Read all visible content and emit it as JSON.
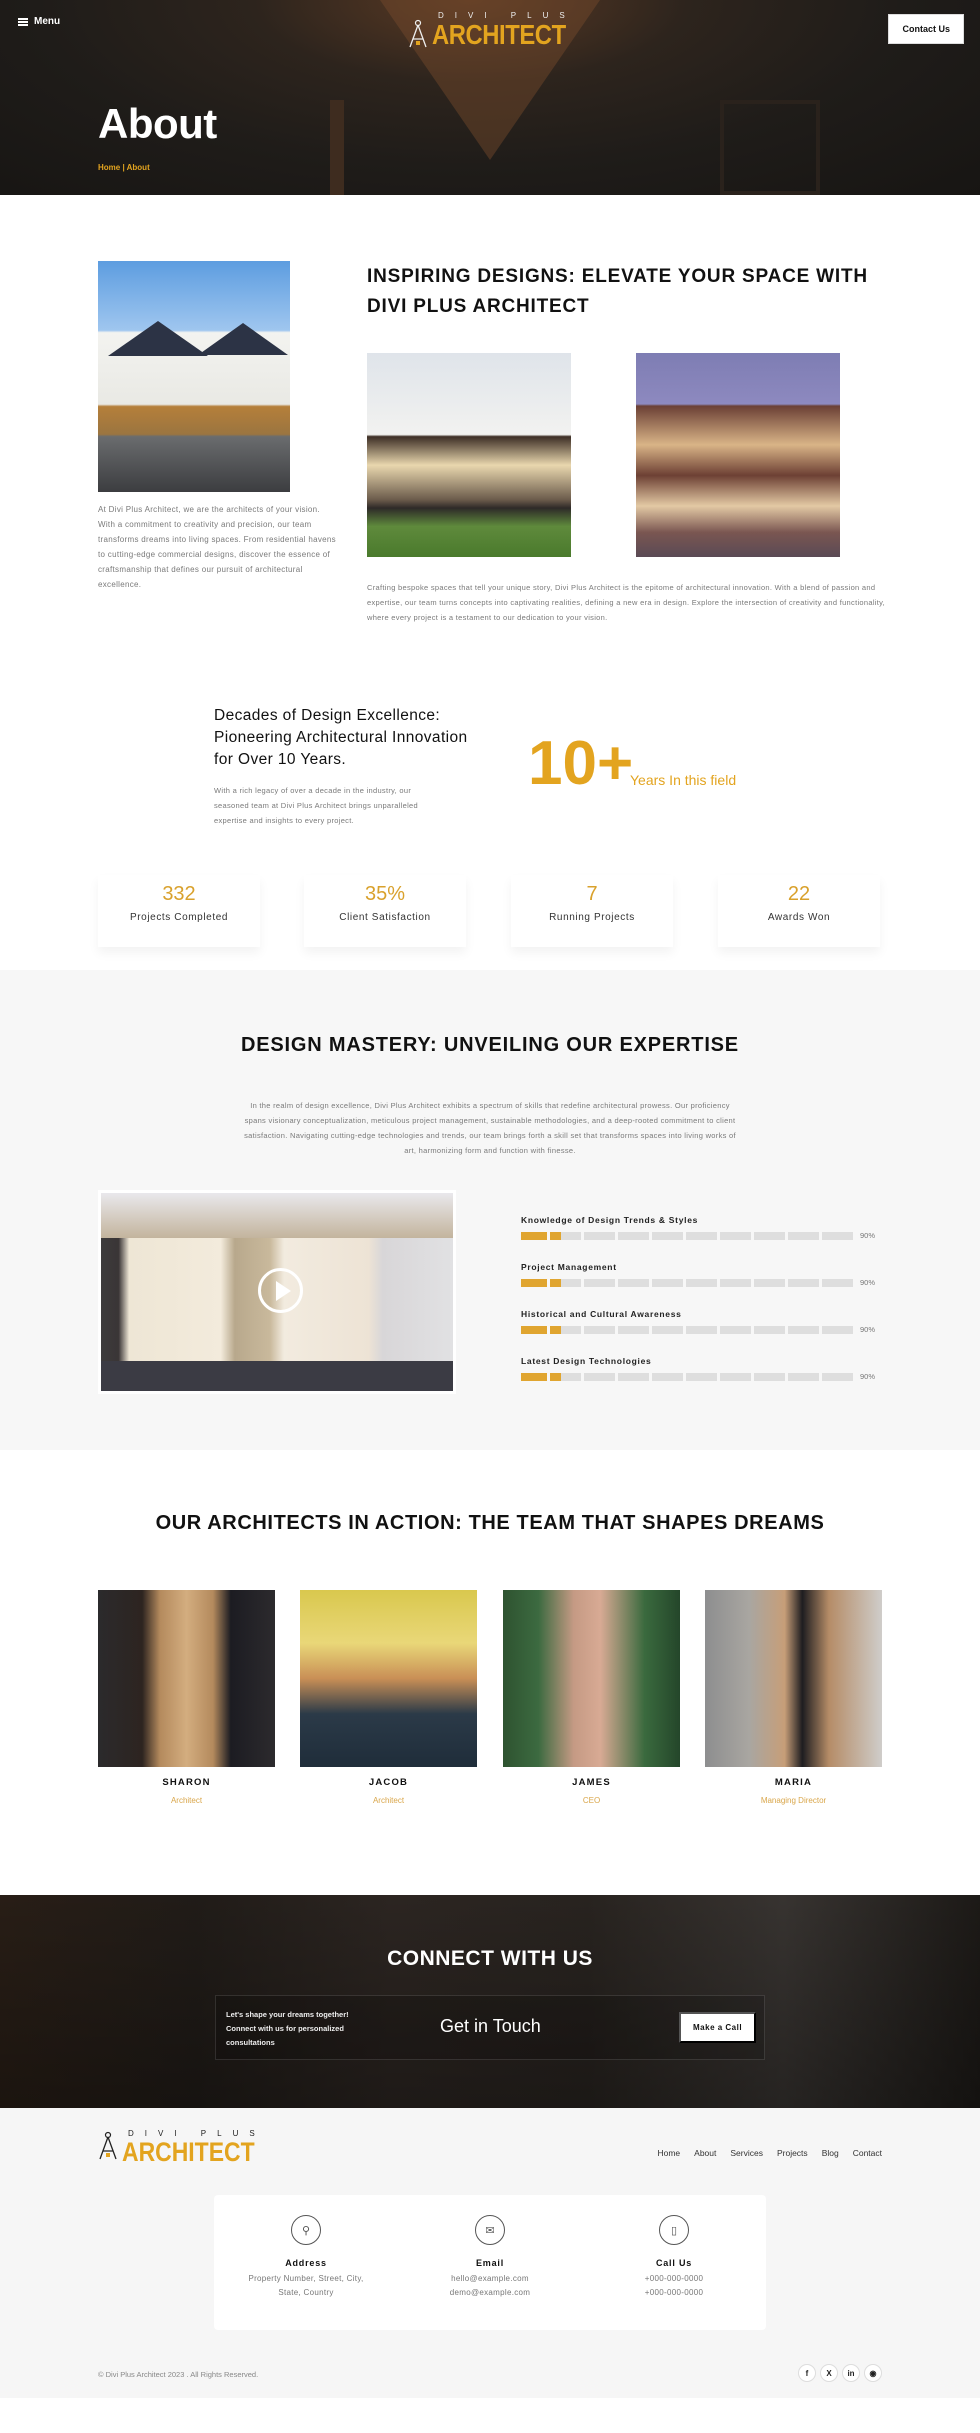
{
  "header": {
    "menu_label": "Menu",
    "logo_top": "DIVI PLUS",
    "logo_main": "ARCHITECT",
    "contact_button": "Contact Us",
    "page_title": "About",
    "breadcrumb": {
      "home": "Home",
      "separator": " | ",
      "current": "About"
    }
  },
  "intro": {
    "left_paragraph": "At Divi Plus Architect, we are the architects of your vision. With a commitment to creativity and precision, our team transforms dreams into living spaces. From residential havens to cutting-edge commercial designs, discover the essence of craftsmanship that defines our pursuit of architectural excellence.",
    "heading": "INSPIRING DESIGNS: ELEVATE YOUR SPACE WITH DIVI PLUS ARCHITECT",
    "right_paragraph": "Crafting bespoke spaces that tell your unique story, Divi Plus Architect is the epitome of architectural innovation. With a blend of passion and expertise, our team turns concepts into captivating realities, defining a new era in design. Explore the intersection of creativity and functionality, where every project is a testament to our dedication to your vision."
  },
  "decades": {
    "heading": "Decades of Design Excellence: Pioneering Architectural Innovation for Over 10 Years.",
    "paragraph": "With a rich legacy of over a decade in the industry, our seasoned team at Divi Plus Architect brings unparalleled expertise and insights to every project.",
    "big_number": "10+",
    "big_label": "Years In this field"
  },
  "stats": [
    {
      "value": "332",
      "label": "Projects Completed"
    },
    {
      "value": "35%",
      "label": "Client Satisfaction"
    },
    {
      "value": "7",
      "label": "Running Projects"
    },
    {
      "value": "22",
      "label": "Awards Won"
    }
  ],
  "expertise": {
    "heading": "DESIGN MASTERY: UNVEILING OUR EXPERTISE",
    "paragraph": "In the realm of design excellence, Divi Plus Architect exhibits a spectrum of skills that redefine architectural prowess. Our proficiency spans visionary conceptualization, meticulous project management, sustainable methodologies, and a deep-rooted commitment to client satisfaction. Navigating cutting-edge technologies and trends, our team brings forth a skill set that transforms spaces into living works of art, harmonizing form and function with finesse.",
    "skills": [
      {
        "name": "Knowledge of Design Trends & Styles",
        "percent_label": "90%",
        "percent": 90
      },
      {
        "name": "Project Management",
        "percent_label": "90%",
        "percent": 90
      },
      {
        "name": "Historical and Cultural Awareness",
        "percent_label": "90%",
        "percent": 90
      },
      {
        "name": "Latest Design Technologies",
        "percent_label": "90%",
        "percent": 90
      }
    ]
  },
  "team": {
    "heading": "OUR ARCHITECTS IN ACTION: THE TEAM THAT SHAPES DREAMS",
    "members": [
      {
        "name": "SHARON",
        "role": "Architect"
      },
      {
        "name": "JACOB",
        "role": "Architect"
      },
      {
        "name": "JAMES",
        "role": "CEO"
      },
      {
        "name": "MARIA",
        "role": "Managing Director"
      }
    ]
  },
  "cta": {
    "heading": "CONNECT WITH US",
    "lead": "Let's shape your dreams together! Connect with us for personalized consultations",
    "title": "Get in Touch",
    "button": "Make a Call"
  },
  "footer": {
    "logo_top": "DIVI PLUS",
    "logo_main": "ARCHITECT",
    "nav": [
      "Home",
      "About",
      "Services",
      "Projects",
      "Blog",
      "Contact"
    ],
    "contacts": [
      {
        "icon": "map-pin-icon",
        "title": "Address",
        "lines": [
          "Property Number, Street, City,",
          "State, Country"
        ]
      },
      {
        "icon": "envelope-icon",
        "title": "Email",
        "lines": [
          "hello@example.com",
          "demo@example.com"
        ]
      },
      {
        "icon": "phone-icon",
        "title": "Call Us",
        "lines": [
          "+000-000-0000",
          "+000-000-0000"
        ]
      }
    ],
    "copyright": "© Divi Plus Architect 2023 . All Rights Reserved.",
    "socials": [
      "facebook-icon",
      "x-icon",
      "linkedin-icon",
      "instagram-icon"
    ]
  },
  "colors": {
    "accent": "#e3a41f",
    "skill_fill": "#e0a530",
    "skill_track": "#dedede",
    "section_gray": "#f7f7f7"
  }
}
